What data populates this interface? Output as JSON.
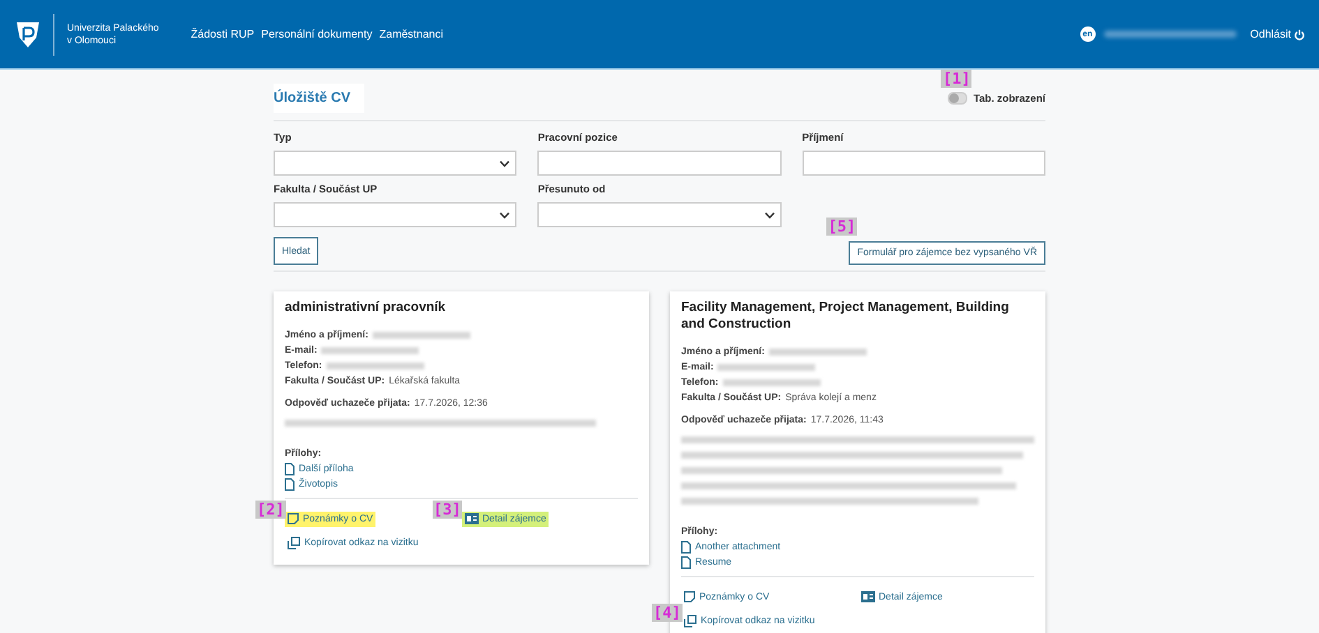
{
  "header": {
    "university": [
      "Univerzita Palackého",
      "v Olomouci"
    ],
    "nav": [
      "Žádosti RUP",
      "Personální dokumenty",
      "Zaměstnanci"
    ],
    "language": "en",
    "user_redacted": true,
    "logout": "Odhlásit"
  },
  "page": {
    "title": "Úložiště CV",
    "toggle": {
      "label": "Tab. zobrazení",
      "on": false,
      "marker": "[1]"
    }
  },
  "filters": [
    {
      "label": "Typ",
      "kind": "select"
    },
    {
      "label": "Pracovní pozice",
      "kind": "text"
    },
    {
      "label": "Příjmení",
      "kind": "text"
    },
    {
      "label": "Fakulta / Součást UP",
      "kind": "select"
    },
    {
      "label": "Přesunuto od",
      "kind": "select"
    }
  ],
  "search_button": "Hledat",
  "form_button": {
    "label": "Formulář pro zájemce bez vypsaného VŘ",
    "marker": "[5]"
  },
  "cards": [
    {
      "title": "administrativní pracovník",
      "fields": [
        {
          "label": "Jméno a příjmení:",
          "redacted": true
        },
        {
          "label": "E-mail:",
          "redacted": true
        },
        {
          "label": "Telefon:",
          "redacted": true
        },
        {
          "label": "Fakulta / Součást UP:",
          "value": "Lékařská fakulta"
        }
      ],
      "response": {
        "label": "Odpověď uchazeče přijata:",
        "value": "17.7.2026, 12:36"
      },
      "message_lines": [
        {
          "redacted": true
        }
      ],
      "attachments_label": "Přílohy:",
      "attachments": [
        "Další příloha",
        "Životopis"
      ],
      "actions": [
        {
          "kind": "notes",
          "label": "Poznámky o CV",
          "marker": "[2]",
          "color": "#fff36b"
        },
        {
          "kind": "detail",
          "label": "Detail zájemce",
          "marker": "[3]",
          "color": "#d4f07a"
        },
        {
          "kind": "copy",
          "label": "Kopírovat odkaz na vizitku"
        }
      ]
    },
    {
      "title": "Facility Management, Project Management, Building and Construction",
      "fields": [
        {
          "label": "Jméno a příjmení:",
          "redacted": true
        },
        {
          "label": "E-mail:",
          "redacted": true
        },
        {
          "label": "Telefon:",
          "redacted": true
        },
        {
          "label": "Fakulta / Součást UP:",
          "value": "Správa kolejí a menz"
        }
      ],
      "response": {
        "label": "Odpověď uchazeče přijata:",
        "value": "17.7.2026, 11:43"
      },
      "message_lines": [
        {
          "redacted": true
        },
        {
          "redacted": true
        },
        {
          "redacted": true
        },
        {
          "redacted": true
        },
        {
          "redacted": true
        }
      ],
      "attachments_label": "Přílohy:",
      "attachments": [
        "Another attachment",
        "Resume"
      ],
      "actions": [
        {
          "kind": "notes",
          "label": "Poznámky o CV"
        },
        {
          "kind": "detail",
          "label": "Detail zájemce"
        },
        {
          "kind": "copy",
          "label": "Kopírovat odkaz na vizitku",
          "marker": "[4]"
        }
      ]
    }
  ]
}
